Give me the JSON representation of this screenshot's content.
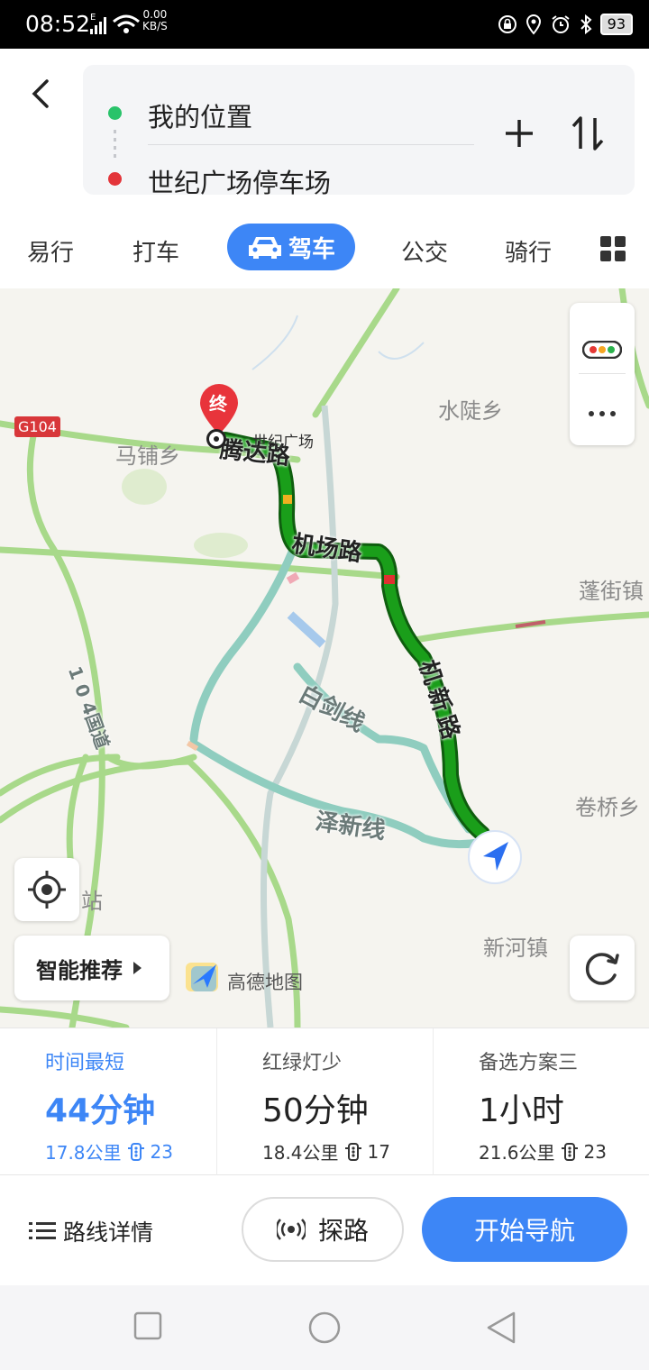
{
  "status_bar": {
    "time": "08:52",
    "net_type": "E",
    "speed_value": "0.00",
    "speed_unit": "KB/S",
    "battery": "93"
  },
  "route": {
    "start": "我的位置",
    "end": "世纪广场停车场"
  },
  "tabs": [
    "易行",
    "打车",
    "驾车",
    "公交",
    "骑行"
  ],
  "active_tab": "驾车",
  "map": {
    "place_labels": [
      "水陡乡",
      "马铺乡",
      "蓬街镇",
      "卷桥乡",
      "新河镇",
      "站"
    ],
    "highway_shield": "G104",
    "destination_marker": "终",
    "poi_name": "世纪广场",
    "road_labels": [
      "腾达路",
      "机场路",
      "机新路",
      "白剑线",
      "泽新线",
      "1 0 4国道"
    ],
    "smart_button": "智能推荐",
    "logo_text": "高德地图",
    "route_color": "#1a9e1a",
    "alt_route_color": "#8fcdbf"
  },
  "plans": [
    {
      "title": "时间最短",
      "duration": "44分钟",
      "distance": "17.8公里",
      "lights": "23"
    },
    {
      "title": "红绿灯少",
      "duration": "50分钟",
      "distance": "18.4公里",
      "lights": "17"
    },
    {
      "title": "备选方案三",
      "duration": "1小时",
      "distance": "21.6公里",
      "lights": "23"
    }
  ],
  "actions": {
    "detail": "路线详情",
    "probe": "探路",
    "start": "开始导航"
  },
  "colors": {
    "accent": "#3d86f6",
    "start_dot": "#29c36a",
    "end_dot": "#e3353a"
  }
}
